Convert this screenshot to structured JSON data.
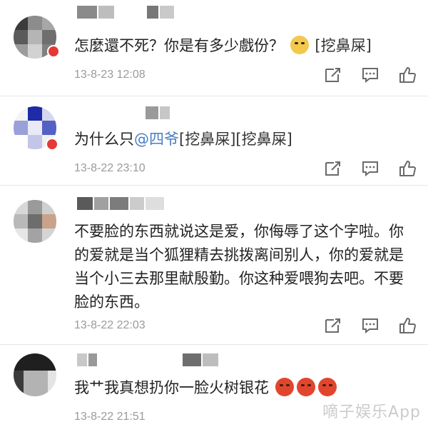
{
  "comments": [
    {
      "text": "怎麼還不死？你是有多少戲份？",
      "tag": "[挖鼻屎]",
      "time": "13-8-23 12:08"
    },
    {
      "text_prefix": "为什么只",
      "mention": "@四爷",
      "tag": "[挖鼻屎][挖鼻屎]",
      "time": "13-8-22 23:10"
    },
    {
      "text": "不要脸的东西就说这是爱，你侮辱了这个字啦。你的爱就是当个狐狸精去挑拨离间别人，你的爱就是当个小三去那里献殷勤。你这种爱喂狗去吧。不要脸的东西。",
      "time": "13-8-22 22:03"
    },
    {
      "text": "我艹我真想扔你一脸火树银花",
      "time": "13-8-22 21:51"
    }
  ],
  "icons": {
    "repost": "repost-icon",
    "comment": "comment-icon",
    "like": "like-icon"
  },
  "watermark": "嘀子娱乐App",
  "colors": {
    "text": "#222222",
    "time": "#9a9a9a",
    "mention": "#4a7dc0",
    "icon": "#6a6a6a",
    "divider": "#e6e6e6"
  }
}
